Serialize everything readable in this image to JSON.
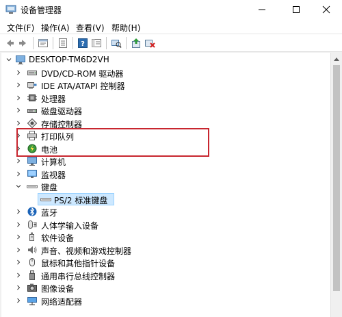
{
  "window": {
    "title": "设备管理器"
  },
  "menu": [
    {
      "label": "文件(F)"
    },
    {
      "label": "操作(A)"
    },
    {
      "label": "查看(V)"
    },
    {
      "label": "帮助(H)"
    }
  ],
  "toolbar": [
    {
      "icon": "back-arrow-icon"
    },
    {
      "icon": "forward-arrow-icon"
    },
    {
      "icon": "properties-icon"
    },
    {
      "icon": "show-hide-icon"
    },
    {
      "icon": "help-icon"
    },
    {
      "icon": "console-icon"
    },
    {
      "icon": "scan-hardware-icon"
    },
    {
      "icon": "update-driver-icon"
    },
    {
      "icon": "uninstall-device-icon"
    }
  ],
  "tree": {
    "root": {
      "label": "DESKTOP-TM6D2VH",
      "expanded": true
    },
    "items": [
      {
        "label": "DVD/CD-ROM 驱动器",
        "icon": "dvd-drive-icon"
      },
      {
        "label": "IDE ATA/ATAPI 控制器",
        "icon": "ide-controller-icon"
      },
      {
        "label": "处理器",
        "icon": "processor-icon"
      },
      {
        "label": "磁盘驱动器",
        "icon": "disk-drive-icon"
      },
      {
        "label": "存储控制器",
        "icon": "storage-controller-icon"
      },
      {
        "label": "打印队列",
        "icon": "printer-icon"
      },
      {
        "label": "电池",
        "icon": "battery-icon"
      },
      {
        "label": "计算机",
        "icon": "computer-icon"
      },
      {
        "label": "监视器",
        "icon": "monitor-icon"
      },
      {
        "label": "键盘",
        "icon": "keyboard-icon",
        "expanded": true,
        "children": [
          {
            "label": "PS/2 标准键盘",
            "icon": "keyboard-icon",
            "selected": true
          }
        ]
      },
      {
        "label": "蓝牙",
        "icon": "bluetooth-icon"
      },
      {
        "label": "人体学输入设备",
        "icon": "hid-icon"
      },
      {
        "label": "软件设备",
        "icon": "software-device-icon"
      },
      {
        "label": "声音、视频和游戏控制器",
        "icon": "sound-icon"
      },
      {
        "label": "鼠标和其他指针设备",
        "icon": "mouse-icon"
      },
      {
        "label": "通用串行总线控制器",
        "icon": "usb-icon"
      },
      {
        "label": "图像设备",
        "icon": "imaging-device-icon"
      },
      {
        "label": "网络适配器",
        "icon": "network-adapter-icon"
      }
    ]
  },
  "colors": {
    "highlight": "#c8262f",
    "selection": "#cde8ff"
  }
}
